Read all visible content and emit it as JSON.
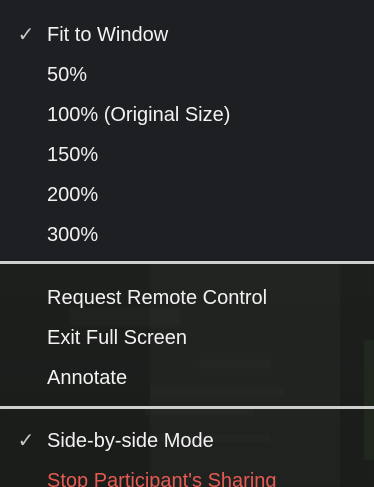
{
  "zoom_section": {
    "items": [
      {
        "label": "Fit to Window",
        "checked": true
      },
      {
        "label": "50%",
        "checked": false
      },
      {
        "label": "100% (Original Size)",
        "checked": false
      },
      {
        "label": "150%",
        "checked": false
      },
      {
        "label": "200%",
        "checked": false
      },
      {
        "label": "300%",
        "checked": false
      }
    ]
  },
  "control_section": {
    "items": [
      {
        "label": "Request Remote Control"
      },
      {
        "label": "Exit Full Screen"
      },
      {
        "label": "Annotate"
      }
    ]
  },
  "view_section": {
    "items": [
      {
        "label": "Side-by-side Mode",
        "checked": true
      },
      {
        "label": "Stop Participant's Sharing"
      }
    ]
  },
  "check_glyph": "✓",
  "colors": {
    "menu_background": "#1e1f22",
    "text": "#f2f2f2",
    "danger_text": "#e45b53",
    "divider": "#cfcfcf"
  }
}
